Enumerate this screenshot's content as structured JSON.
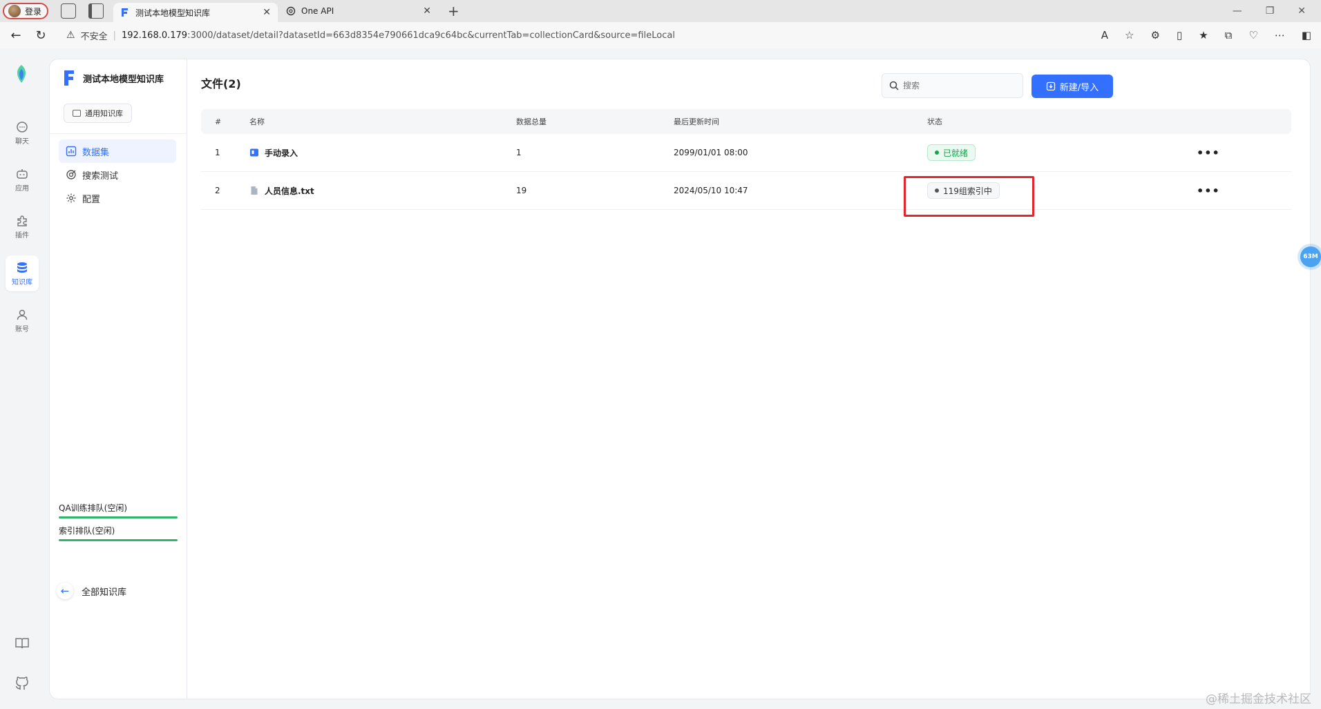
{
  "browser": {
    "profile_label": "登录",
    "tabs": [
      {
        "title": "测试本地模型知识库",
        "active": true
      },
      {
        "title": "One API",
        "active": false
      }
    ],
    "security_label": "不安全",
    "url_host": "192.168.0.179",
    "url_rest": ":3000/dataset/detail?datasetId=663d8354e790661dca9c64bc&currentTab=collectionCard&source=fileLocal"
  },
  "left_nav": [
    {
      "label": "聊天",
      "icon": "chat-icon"
    },
    {
      "label": "应用",
      "icon": "robot-icon"
    },
    {
      "label": "插件",
      "icon": "puzzle-icon"
    },
    {
      "label": "知识库",
      "icon": "database-icon",
      "active": true
    },
    {
      "label": "账号",
      "icon": "user-icon"
    }
  ],
  "sidebar": {
    "kb_name": "测试本地模型知识库",
    "kb_type": "通用知识库",
    "menu": [
      {
        "label": "数据集",
        "active": true
      },
      {
        "label": "搜索测试"
      },
      {
        "label": "配置"
      }
    ],
    "queues": [
      {
        "label": "QA训练排队(空闲)"
      },
      {
        "label": "索引排队(空闲)"
      }
    ],
    "back_label": "全部知识库"
  },
  "main": {
    "title": "文件(2)",
    "search_placeholder": "搜索",
    "new_button": "新建/导入",
    "columns": [
      "#",
      "名称",
      "数据总量",
      "最后更新时间",
      "状态"
    ],
    "rows": [
      {
        "num": "1",
        "name": "手动录入",
        "total": "1",
        "time": "2099/01/01 08:00",
        "status": "已就绪",
        "status_type": "ready"
      },
      {
        "num": "2",
        "name": "人员信息.txt",
        "total": "19",
        "time": "2024/05/10 10:47",
        "status": "119组索引中",
        "status_type": "indexing"
      }
    ]
  },
  "float_badge": "63M",
  "watermark": "@稀土掘金技术社区",
  "colors": {
    "accent": "#3370ff",
    "ready": "#16a34a",
    "highlight": "#e5252a"
  }
}
